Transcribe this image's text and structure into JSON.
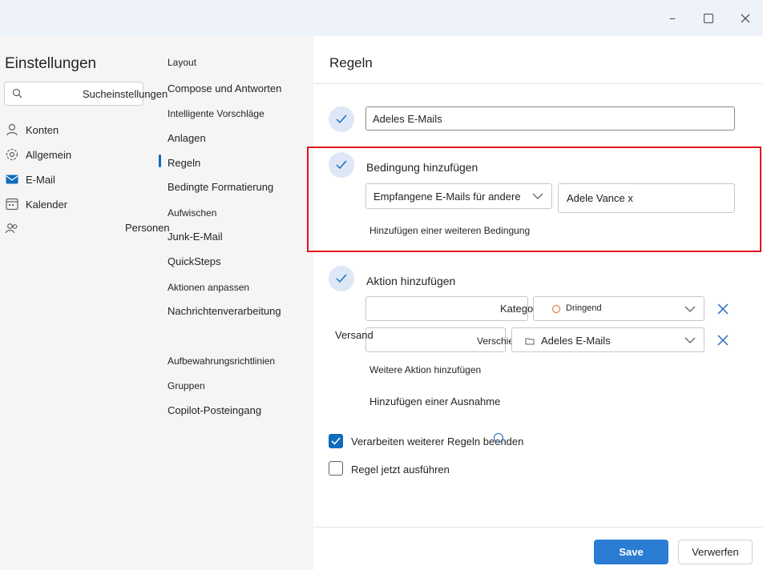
{
  "window": {
    "minimize_icon": "minimize-icon",
    "maximize_icon": "maximize-icon",
    "close_icon": "close-icon"
  },
  "settings": {
    "title": "Einstellungen",
    "search_placeholder": "Sucheinstellungen"
  },
  "nav": [
    {
      "label": "Konten",
      "icon": "person-icon"
    },
    {
      "label": "Allgemein",
      "icon": "gear-icon"
    },
    {
      "label": "E-Mail",
      "icon": "mail-icon"
    },
    {
      "label": "Kalender",
      "icon": "calendar-icon"
    },
    {
      "label": "Personen",
      "icon": "people-icon"
    }
  ],
  "mail_subnav": [
    "Layout",
    "Compose und Antworten",
    "Intelligente Vorschläge",
    "Anlagen",
    "Regeln",
    "Bedingte Formatierung",
    "Aufwischen",
    "Junk-E-Mail",
    "QuickSteps",
    "Aktionen anpassen",
    "Nachrichtenverarbeitung",
    "Versand",
    "Aufbewahrungsrichtlinien",
    "Gruppen",
    "Copilot-Posteingang"
  ],
  "rules": {
    "title": "Regeln",
    "rule_name": "Adeles E-Mails",
    "condition": {
      "heading": "Bedingung hinzufügen",
      "type": "Empfangene E-Mails für andere",
      "value": "Adele Vance x",
      "add_more": "Hinzufügen einer weiteren Bedingung"
    },
    "action": {
      "heading": "Aktion hinzufügen",
      "rows": [
        {
          "action": "Kategorisieren",
          "value": "Dringend"
        },
        {
          "action": "Verschieben in",
          "value": "Adeles E-Mails"
        }
      ],
      "add_more": "Weitere Aktion hinzufügen"
    },
    "add_exception": "Hinzufügen einer Ausnahme",
    "stop_processing": {
      "label": "Verarbeiten weiterer Regeln beenden",
      "checked": true
    },
    "run_now": {
      "label": "Regel jetzt ausführen",
      "checked": false
    }
  },
  "buttons": {
    "save": "Save",
    "cancel": "Verwerfen"
  },
  "colors": {
    "accent": "#0f6cbd",
    "save_bg": "#2b7cd3",
    "highlight": "#e3131b"
  }
}
